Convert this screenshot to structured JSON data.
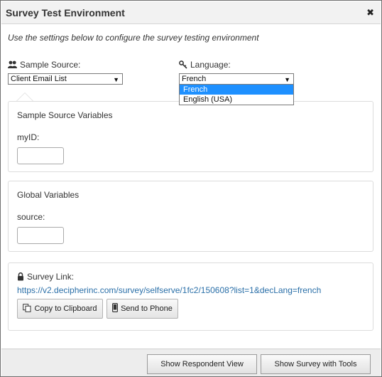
{
  "dialog": {
    "title": "Survey Test Environment",
    "close_glyph": "✖",
    "intro": "Use the settings below to configure the survey testing environment"
  },
  "sample_source": {
    "icon": "users-icon",
    "label": "Sample Source:",
    "selected": "Client Email List"
  },
  "language": {
    "icon": "key-icon",
    "label": "Language:",
    "selected": "French",
    "options": [
      "French",
      "English (USA)"
    ],
    "highlighted_option": "French"
  },
  "panels": {
    "sample_source_variables": {
      "heading": "Sample Source Variables",
      "field_label": "myID:",
      "field_value": ""
    },
    "global_variables": {
      "heading": "Global Variables",
      "field_label": "source:",
      "field_value": ""
    },
    "survey_link": {
      "icon": "lock-icon",
      "label": "Survey Link:",
      "url": "https://v2.decipherinc.com/survey/selfserve/1fc2/150608?list=1&decLang=french",
      "copy_button": "Copy to Clipboard",
      "copy_icon": "clipboard-icon",
      "phone_button": "Send to Phone",
      "phone_icon": "phone-icon"
    }
  },
  "footer": {
    "respondent_view_button": "Show Respondent View",
    "tools_button": "Show Survey with Tools"
  },
  "colors": {
    "link": "#2a6fa8",
    "selection": "#1e90ff",
    "title_bar": "#f2f2f2"
  }
}
